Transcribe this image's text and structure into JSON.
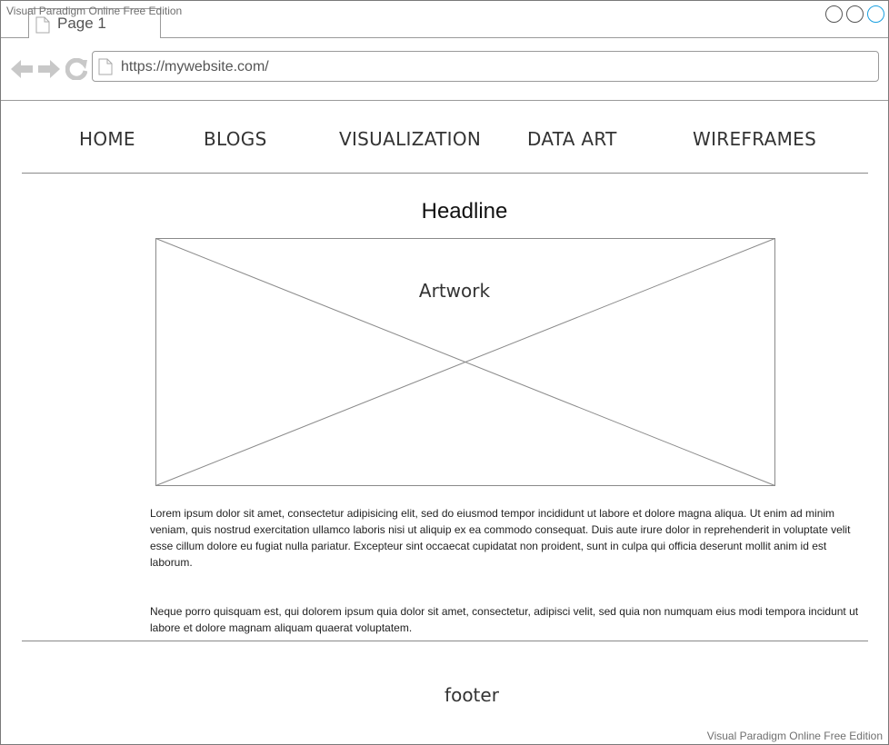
{
  "watermark": "Visual Paradigm Online Free Edition",
  "browser": {
    "tab_label": "Page 1",
    "url": "https://mywebsite.com/",
    "icons": [
      "back-arrow-icon",
      "forward-arrow-icon",
      "refresh-icon",
      "document-icon"
    ],
    "window_buttons": [
      "minimize",
      "maximize",
      "close"
    ],
    "accent_color": "#1aa0e0"
  },
  "site": {
    "nav": [
      "HOME",
      "BLOGS",
      "VISUALIZATION",
      "DATA ART",
      "WIREFRAMES"
    ],
    "headline": "Headline",
    "artwork_label": "Artwork",
    "paragraphs": [
      "Lorem ipsum dolor sit amet, consectetur adipisicing elit, sed do eiusmod tempor incididunt ut labore et dolore magna aliqua. Ut enim ad minim veniam, quis nostrud exercitation ullamco laboris nisi ut aliquip ex ea commodo consequat. Duis aute irure dolor in reprehenderit in voluptate velit esse cillum dolore eu fugiat nulla pariatur. Excepteur sint occaecat cupidatat non proident, sunt in culpa qui officia deserunt mollit anim id est laborum.",
      "Neque porro quisquam est, qui dolorem ipsum quia dolor sit amet, consectetur, adipisci velit, sed quia non numquam eius modi tempora incidunt ut labore et dolore magnam aliquam quaerat voluptatem."
    ],
    "footer": "footer"
  }
}
